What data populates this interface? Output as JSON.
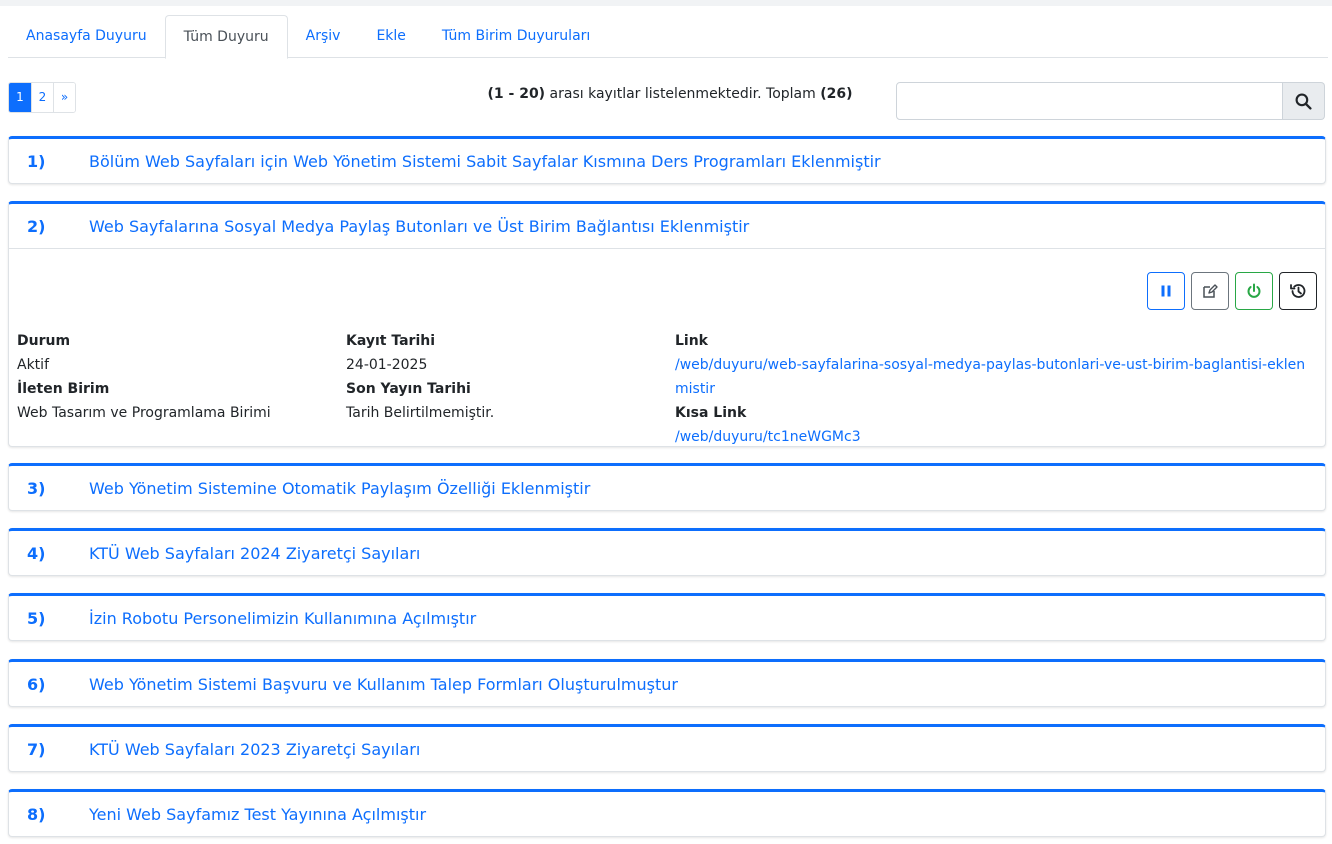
{
  "tabs": [
    {
      "label": "Anasayfa Duyuru",
      "active": false
    },
    {
      "label": "Tüm Duyuru",
      "active": true
    },
    {
      "label": "Arşiv",
      "active": false
    },
    {
      "label": "Ekle",
      "active": false
    },
    {
      "label": "Tüm Birim Duyuruları",
      "active": false
    }
  ],
  "pagination": {
    "pages": [
      "1",
      "2"
    ],
    "next": "»",
    "current": "1"
  },
  "record_info": {
    "range": "(1 - 20)",
    "text": "arası kayıtlar listelenmektedir. Toplam",
    "total": "(26)"
  },
  "search": {
    "value": "",
    "placeholder": ""
  },
  "announcements": [
    {
      "num": "1)",
      "title": "Bölüm Web Sayfaları için Web Yönetim Sistemi Sabit Sayfalar Kısmına Ders Programları Eklenmiştir"
    },
    {
      "num": "2)",
      "title": "Web Sayfalarına Sosyal Medya Paylaş Butonları ve Üst Birim Bağlantısı Eklenmiştir"
    },
    {
      "num": "3)",
      "title": "Web Yönetim Sistemine Otomatik Paylaşım Özelliği Eklenmiştir"
    },
    {
      "num": "4)",
      "title": "KTÜ Web Sayfaları 2024 Ziyaretçi Sayıları"
    },
    {
      "num": "5)",
      "title": "İzin Robotu Personelimizin Kullanımına Açılmıştır"
    },
    {
      "num": "6)",
      "title": "Web Yönetim Sistemi Başvuru ve Kullanım Talep Formları Oluşturulmuştur"
    },
    {
      "num": "7)",
      "title": "KTÜ Web Sayfaları 2023 Ziyaretçi Sayıları"
    },
    {
      "num": "8)",
      "title": "Yeni Web Sayfamız Test Yayınına Açılmıştır"
    }
  ],
  "expanded": {
    "durum_label": "Durum",
    "durum_value": "Aktif",
    "ileten_label": "İleten Birim",
    "ileten_value": "Web Tasarım ve Programlama Birimi",
    "kayit_label": "Kayıt Tarihi",
    "kayit_value": "24-01-2025",
    "son_label": "Son Yayın Tarihi",
    "son_value": "Tarih Belirtilmemiştir.",
    "link_label": "Link",
    "link_value": "/web/duyuru/web-sayfalarina-sosyal-medya-paylas-butonlari-ve-ust-birim-baglantisi-eklenmistir",
    "kisa_label": "Kısa Link",
    "kisa_value": "/web/duyuru/tc1neWGMc3"
  },
  "icons": {
    "search": "search-icon",
    "pause": "pause-icon",
    "edit": "edit-icon",
    "power": "power-icon",
    "history": "history-icon"
  },
  "colors": {
    "primary": "#0d6efd",
    "success": "#28a745",
    "secondary": "#6c757d"
  }
}
